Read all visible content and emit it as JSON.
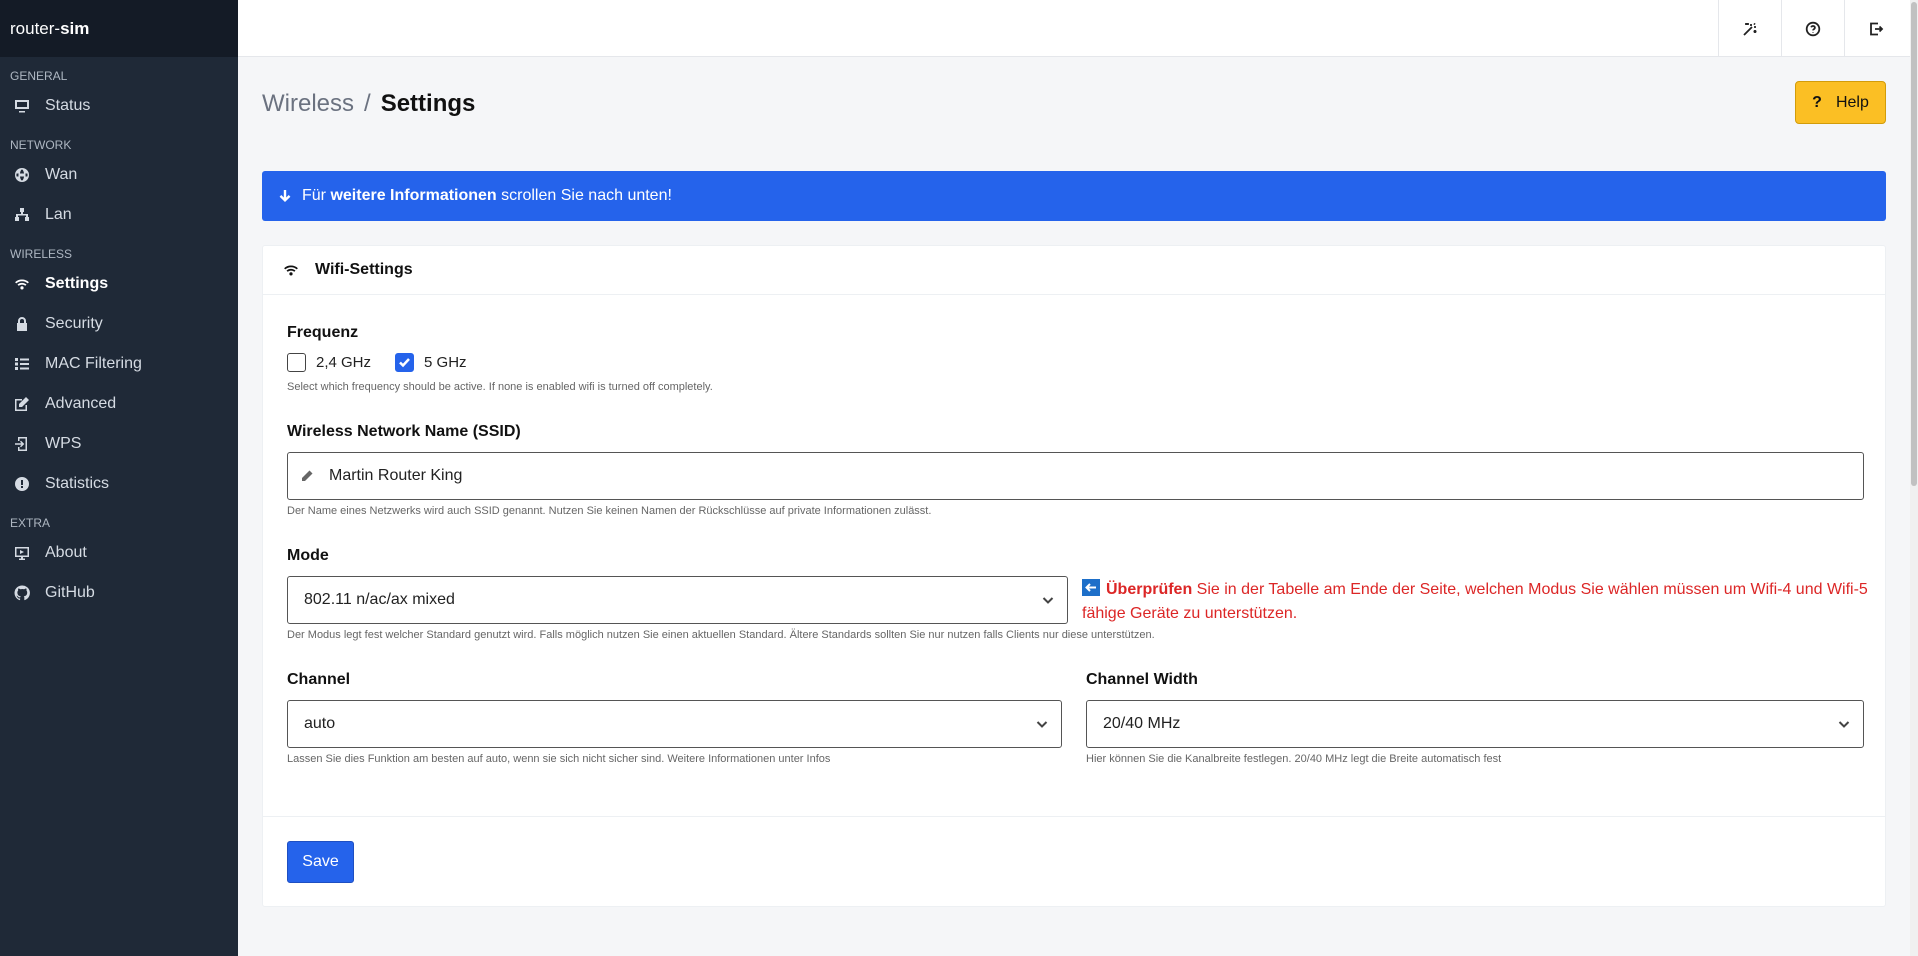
{
  "app": {
    "brand_prefix": "router-",
    "brand_bold": "sim"
  },
  "sidebar": {
    "sections": [
      {
        "label": "GENERAL"
      },
      {
        "label": "NETWORK"
      },
      {
        "label": "WIRELESS"
      },
      {
        "label": "EXTRA"
      }
    ],
    "items": [
      {
        "label": "Status",
        "icon": "monitor-icon"
      },
      {
        "label": "Wan",
        "icon": "globe-icon"
      },
      {
        "label": "Lan",
        "icon": "network-icon"
      },
      {
        "label": "Settings",
        "icon": "wifi-icon",
        "active": true
      },
      {
        "label": "Security",
        "icon": "lock-icon"
      },
      {
        "label": "MAC Filtering",
        "icon": "list-icon"
      },
      {
        "label": "Advanced",
        "icon": "edit-icon"
      },
      {
        "label": "WPS",
        "icon": "login-icon"
      },
      {
        "label": "Statistics",
        "icon": "alert-circle-icon"
      },
      {
        "label": "About",
        "icon": "display-icon"
      },
      {
        "label": "GitHub",
        "icon": "github-icon"
      }
    ]
  },
  "topbar": {
    "icons": [
      "magic-wand-icon",
      "help-circle-icon",
      "logout-icon"
    ]
  },
  "page": {
    "breadcrumb_parent": "Wireless",
    "breadcrumb_sep": "/",
    "breadcrumb_current": "Settings",
    "help_label": "Help",
    "help_symbol": "?"
  },
  "banner": {
    "prefix": "Für ",
    "bold": "weitere Informationen",
    "suffix": " scrollen Sie nach unten!"
  },
  "card": {
    "title": "Wifi-Settings",
    "frequency": {
      "label": "Frequenz",
      "options": [
        {
          "label": "2,4 GHz",
          "checked": false
        },
        {
          "label": "5 GHz",
          "checked": true
        }
      ],
      "help": "Select which frequency should be active. If none is enabled wifi is turned off completely."
    },
    "ssid": {
      "label": "Wireless Network Name (SSID)",
      "value": "Martin Router King",
      "help": "Der Name eines Netzwerks wird auch SSID genannt. Nutzen Sie keinen Namen der Rückschlüsse auf private Informationen zulässt."
    },
    "mode": {
      "label": "Mode",
      "value": "802.11 n/ac/ax mixed",
      "help": "Der Modus legt fest welcher Standard genutzt wird. Falls möglich nutzen Sie einen aktuellen Standard. Ältere Standards sollten Sie nur nutzen falls Clients nur diese unterstützen.",
      "warn_bold": "Überprüfen",
      "warn_text": " Sie in der Tabelle am Ende der Seite, welchen Modus Sie wählen müssen um Wifi-4 und Wifi-5 fähige Geräte zu unterstützen."
    },
    "channel": {
      "label": "Channel",
      "value": "auto",
      "help": "Lassen Sie dies Funktion am besten auf auto, wenn sie sich nicht sicher sind. Weitere Informationen unter Infos"
    },
    "channel_width": {
      "label": "Channel Width",
      "value": "20/40 MHz",
      "help": "Hier können Sie die Kanalbreite festlegen. 20/40 MHz legt die Breite automatisch fest"
    },
    "save_label": "Save"
  },
  "colors": {
    "accent": "#2563eb",
    "sidebar": "#1f2937",
    "warning": "#dc2626",
    "help_button": "#fbbf24"
  }
}
